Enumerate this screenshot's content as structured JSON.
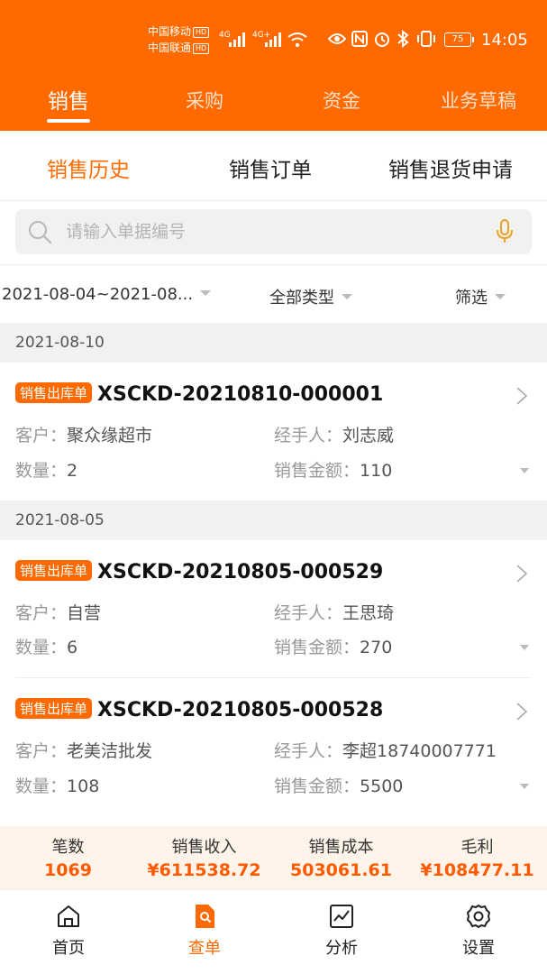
{
  "status_bar": {
    "carrier1": "中国移动",
    "carrier2": "中国联通",
    "hd": "HD",
    "net1": "4G",
    "net2": "4G+",
    "battery": "75",
    "time": "14:05"
  },
  "top_tabs": [
    {
      "label": "销售",
      "active": true
    },
    {
      "label": "采购",
      "active": false
    },
    {
      "label": "资金",
      "active": false
    },
    {
      "label": "业务草稿",
      "active": false
    }
  ],
  "sub_tabs": [
    {
      "label": "销售历史",
      "active": true
    },
    {
      "label": "销售订单",
      "active": false
    },
    {
      "label": "销售退货申请",
      "active": false
    }
  ],
  "search": {
    "placeholder": "请输入单据编号",
    "value": ""
  },
  "filters": {
    "date_range": "2021-08-04~2021-08...",
    "type": "全部类型",
    "filter": "筛选"
  },
  "labels": {
    "customer": "客户：",
    "handler": "经手人：",
    "quantity": "数量：",
    "amount": "销售金额："
  },
  "groups": [
    {
      "date": "2021-08-10",
      "orders": [
        {
          "badge": "销售出库单",
          "number": "XSCKD-20210810-000001",
          "customer": "聚众缘超市",
          "handler": "刘志威",
          "quantity": "2",
          "amount": "110"
        }
      ]
    },
    {
      "date": "2021-08-05",
      "orders": [
        {
          "badge": "销售出库单",
          "number": "XSCKD-20210805-000529",
          "customer": "自营",
          "handler": "王思琦",
          "quantity": "6",
          "amount": "270"
        },
        {
          "badge": "销售出库单",
          "number": "XSCKD-20210805-000528",
          "customer": "老美洁批发",
          "handler": "李超18740007771",
          "quantity": "108",
          "amount": "5500"
        }
      ]
    }
  ],
  "summary": [
    {
      "label": "笔数",
      "value": "1069"
    },
    {
      "label": "销售收入",
      "value": "¥611538.72"
    },
    {
      "label": "销售成本",
      "value": "503061.61"
    },
    {
      "label": "毛利",
      "value": "¥108477.11"
    }
  ],
  "bottom_nav": [
    {
      "label": "首页",
      "icon": "home-icon",
      "active": false
    },
    {
      "label": "查单",
      "icon": "search-doc-icon",
      "active": true
    },
    {
      "label": "分析",
      "icon": "chart-icon",
      "active": false
    },
    {
      "label": "设置",
      "icon": "gear-icon",
      "active": false
    }
  ],
  "colors": {
    "brand": "#ff6a00",
    "summary_bg": "#fff4ea"
  }
}
